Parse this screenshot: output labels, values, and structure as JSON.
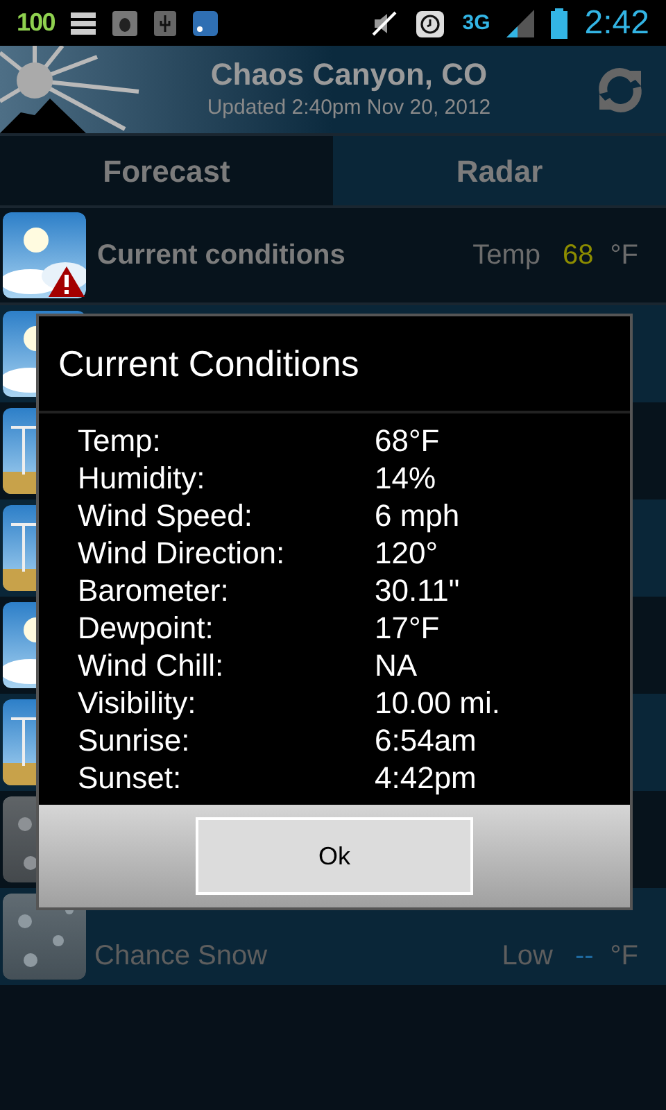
{
  "status_bar": {
    "battery_level_badge": "100",
    "network": "3G",
    "time": "2:42"
  },
  "header": {
    "location": "Chaos Canyon, CO",
    "updated": "Updated 2:40pm Nov 20, 2012"
  },
  "tabs": [
    {
      "label": "Forecast",
      "selected": true
    },
    {
      "label": "Radar",
      "selected": false
    }
  ],
  "current": {
    "title": "Current conditions",
    "temp_label": "Temp",
    "temp": "68",
    "unit": "°F",
    "alert": true
  },
  "forecast_rows": [
    {
      "kind": "sun"
    },
    {
      "kind": "wind"
    },
    {
      "kind": "wind"
    },
    {
      "kind": "sun"
    },
    {
      "kind": "wind"
    },
    {
      "kind": "snow"
    },
    {
      "kind": "snow",
      "description": "Chance Snow",
      "low_label": "Low",
      "low": "--",
      "unit": "°F"
    }
  ],
  "dialog": {
    "title": "Current Conditions",
    "rows": [
      {
        "label": "Temp:",
        "value": "68°F"
      },
      {
        "label": "Humidity:",
        "value": "14%"
      },
      {
        "label": "Wind Speed:",
        "value": "6 mph"
      },
      {
        "label": "Wind Direction:",
        "value": "120°"
      },
      {
        "label": "Barometer:",
        "value": "30.11\""
      },
      {
        "label": "Dewpoint:",
        "value": "17°F"
      },
      {
        "label": "Wind Chill:",
        "value": "NA"
      },
      {
        "label": "Visibility:",
        "value": "10.00 mi."
      },
      {
        "label": "Sunrise:",
        "value": "6:54am"
      },
      {
        "label": "Sunset:",
        "value": "4:42pm"
      }
    ],
    "button": "Ok"
  }
}
